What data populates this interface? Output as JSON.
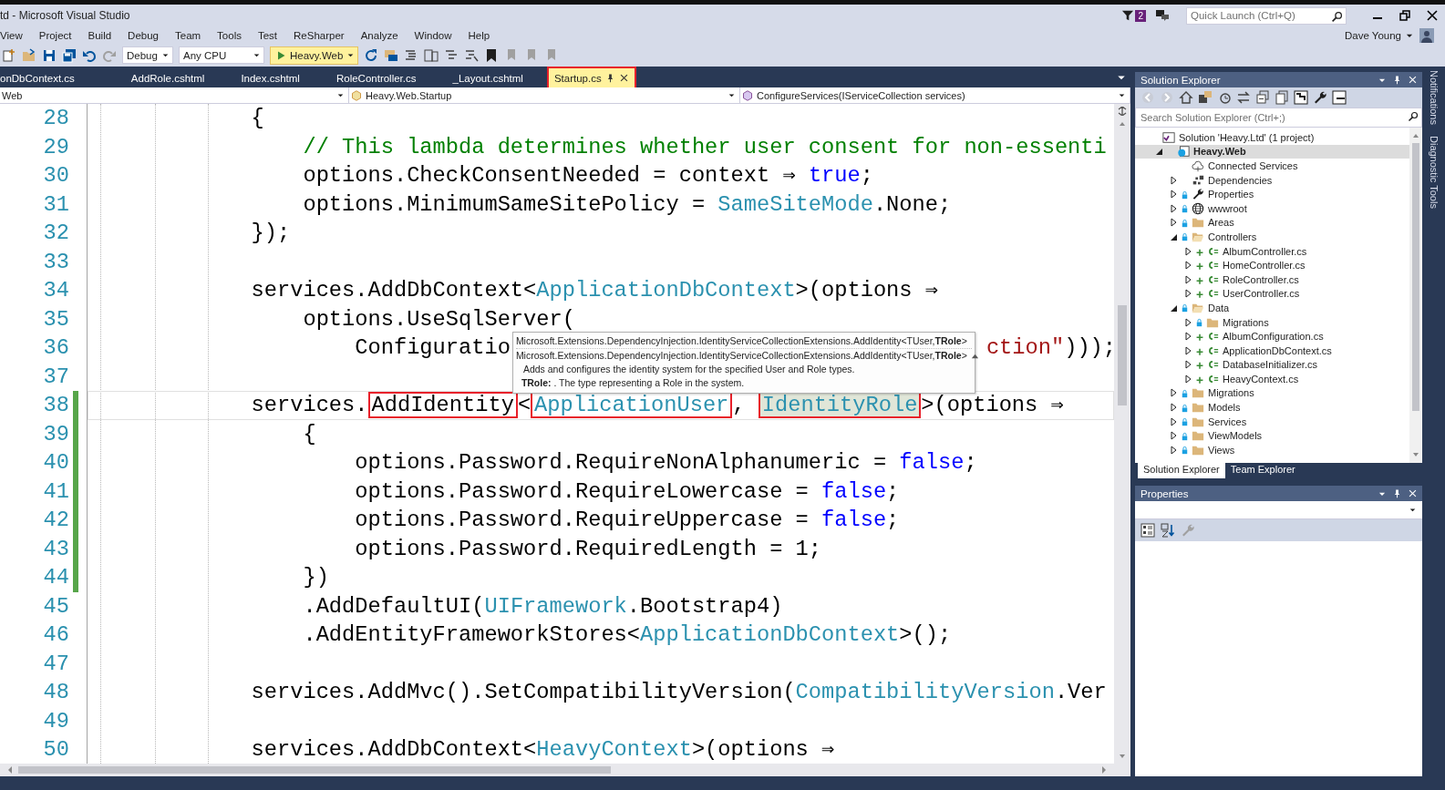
{
  "window": {
    "title": "td - Microsoft Visual Studio"
  },
  "notifications": {
    "count": "2"
  },
  "quick_launch": {
    "placeholder": "Quick Launch (Ctrl+Q)"
  },
  "menu": [
    "View",
    "Project",
    "Build",
    "Debug",
    "Team",
    "Tools",
    "Test",
    "ReSharper",
    "Analyze",
    "Window",
    "Help"
  ],
  "account": {
    "name": "Dave Young"
  },
  "toolbar": {
    "configuration": "Debug",
    "platform": "Any CPU",
    "start": "Heavy.Web"
  },
  "tabs": [
    {
      "label": "onDbContext.cs",
      "selected": false,
      "boxed": false
    },
    {
      "label": "AddRole.cshtml",
      "selected": false,
      "boxed": false
    },
    {
      "label": "Index.cshtml",
      "selected": false,
      "boxed": false
    },
    {
      "label": "RoleController.cs",
      "selected": false,
      "boxed": false
    },
    {
      "label": "_Layout.cshtml",
      "selected": false,
      "boxed": false
    },
    {
      "label": "Startup.cs",
      "selected": true,
      "boxed": true
    }
  ],
  "navigation": {
    "project": "Web",
    "type": "Heavy.Web.Startup",
    "member": "ConfigureServices(IServiceCollection services)"
  },
  "editor": {
    "lines": [
      {
        "n": "28",
        "changed": false,
        "current": false,
        "tokens": [
          {
            "t": "            {",
            "kind": "plain"
          }
        ]
      },
      {
        "n": "29",
        "changed": false,
        "current": false,
        "tokens": [
          {
            "t": "                // This lambda determines whether user consent for non-essenti",
            "kind": "comment"
          }
        ]
      },
      {
        "n": "30",
        "changed": false,
        "current": false,
        "tokens": [
          {
            "t": "                options.CheckConsentNeeded = context ⇒ ",
            "kind": "plain"
          },
          {
            "t": "true",
            "kind": "keyword"
          },
          {
            "t": ";",
            "kind": "plain"
          }
        ]
      },
      {
        "n": "31",
        "changed": false,
        "current": false,
        "tokens": [
          {
            "t": "                options.MinimumSameSitePolicy = ",
            "kind": "plain"
          },
          {
            "t": "SameSiteMode",
            "kind": "type"
          },
          {
            "t": ".None;",
            "kind": "plain"
          }
        ]
      },
      {
        "n": "32",
        "changed": false,
        "current": false,
        "tokens": [
          {
            "t": "            });",
            "kind": "plain"
          }
        ]
      },
      {
        "n": "33",
        "changed": false,
        "current": false
      },
      {
        "n": "34",
        "changed": false,
        "current": false,
        "tokens": [
          {
            "t": "            services.AddDbContext<",
            "kind": "plain"
          },
          {
            "t": "ApplicationDbContext",
            "kind": "type"
          },
          {
            "t": ">(options ⇒",
            "kind": "plain"
          }
        ]
      },
      {
        "n": "35",
        "changed": false,
        "current": false,
        "tokens": [
          {
            "t": "                options.UseSqlServer(",
            "kind": "plain"
          }
        ]
      },
      {
        "n": "36",
        "changed": false,
        "current": false,
        "tokens": [
          {
            "t": "                    Configuratio",
            "kind": "plain"
          },
          {
            "kind": "popup"
          },
          {
            "t": "ction\"",
            "kind": "string"
          },
          {
            "t": ")));",
            "kind": "plain"
          }
        ]
      },
      {
        "n": "37",
        "changed": false,
        "current": false
      },
      {
        "n": "38",
        "changed": true,
        "current": true,
        "tokens": [
          {
            "t": "            services.",
            "kind": "plain",
            "boxed": false,
            "highlighted": false
          },
          {
            "t": "AddIdentity",
            "kind": "plain",
            "boxed": true,
            "highlighted": false
          },
          {
            "t": "<",
            "kind": "plain",
            "boxed": false,
            "highlighted": false
          },
          {
            "t": "ApplicationUser",
            "kind": "type",
            "boxed": true,
            "highlighted": false
          },
          {
            "t": ", ",
            "kind": "plain",
            "boxed": false,
            "highlighted": false
          },
          {
            "t": "IdentityRole",
            "kind": "type",
            "boxed": true,
            "highlighted": true
          },
          {
            "t": ">(options ⇒",
            "kind": "plain",
            "boxed": false,
            "highlighted": false
          }
        ]
      },
      {
        "n": "39",
        "changed": true,
        "current": false,
        "tokens": [
          {
            "t": "                {",
            "kind": "plain"
          }
        ]
      },
      {
        "n": "40",
        "changed": true,
        "current": false,
        "tokens": [
          {
            "t": "                    options.Password.RequireNonAlphanumeric = ",
            "kind": "plain"
          },
          {
            "t": "false",
            "kind": "keyword"
          },
          {
            "t": ";",
            "kind": "plain"
          }
        ]
      },
      {
        "n": "41",
        "changed": true,
        "current": false,
        "tokens": [
          {
            "t": "                    options.Password.RequireLowercase = ",
            "kind": "plain"
          },
          {
            "t": "false",
            "kind": "keyword"
          },
          {
            "t": ";",
            "kind": "plain"
          }
        ]
      },
      {
        "n": "42",
        "changed": true,
        "current": false,
        "tokens": [
          {
            "t": "                    options.Password.RequireUppercase = ",
            "kind": "plain"
          },
          {
            "t": "false",
            "kind": "keyword"
          },
          {
            "t": ";",
            "kind": "plain"
          }
        ]
      },
      {
        "n": "43",
        "changed": true,
        "current": false,
        "tokens": [
          {
            "t": "                    options.Password.RequiredLength = 1;",
            "kind": "plain"
          }
        ]
      },
      {
        "n": "44",
        "changed": true,
        "current": false,
        "tokens": [
          {
            "t": "                })",
            "kind": "plain"
          }
        ]
      },
      {
        "n": "45",
        "changed": false,
        "current": false,
        "tokens": [
          {
            "t": "                .AddDefaultUI(",
            "kind": "plain"
          },
          {
            "t": "UIFramework",
            "kind": "type"
          },
          {
            "t": ".Bootstrap4)",
            "kind": "plain"
          }
        ]
      },
      {
        "n": "46",
        "changed": false,
        "current": false,
        "tokens": [
          {
            "t": "                .AddEntityFrameworkStores<",
            "kind": "plain"
          },
          {
            "t": "ApplicationDbContext",
            "kind": "type"
          },
          {
            "t": ">();",
            "kind": "plain"
          }
        ]
      },
      {
        "n": "47",
        "changed": false,
        "current": false
      },
      {
        "n": "48",
        "changed": false,
        "current": false,
        "tokens": [
          {
            "t": "            services.AddMvc().SetCompatibilityVersion(",
            "kind": "plain"
          },
          {
            "t": "CompatibilityVersion",
            "kind": "type"
          },
          {
            "t": ".Ver",
            "kind": "plain"
          }
        ]
      },
      {
        "n": "49",
        "changed": false,
        "current": false
      },
      {
        "n": "50",
        "changed": false,
        "current": false,
        "tokens": [
          {
            "t": "            services.AddDbContext<",
            "kind": "plain"
          },
          {
            "t": "HeavyContext",
            "kind": "type"
          },
          {
            "t": ">(options ⇒",
            "kind": "plain"
          }
        ]
      }
    ],
    "tooltip": {
      "signatures": [
        "Microsoft.Extensions.DependencyInjection.IdentityServiceCollectionExtensions.AddIdentity<TUser,**TRole**>",
        "Microsoft.Extensions.DependencyInjection.IdentityServiceCollectionExtensions.AddIdentity<TUser,**TRole**>"
      ],
      "description": "Adds and configures the identity system for the specified User and Role types.",
      "parameter": "**TRole:** . The type representing a Role in the system."
    }
  },
  "solution_explorer": {
    "title": "Solution Explorer",
    "search_placeholder": "Search Solution Explorer (Ctrl+;)",
    "tree": [
      {
        "label": "Solution 'Heavy.Ltd' (1 project)",
        "kind": "solution",
        "selected": false,
        "locked": false,
        "added": false,
        "children": [
          {
            "label": "Heavy.Web",
            "kind": "web-project",
            "selected": true,
            "expanded": true,
            "locked": false,
            "added": false,
            "children": [
              {
                "label": "Connected Services",
                "kind": "cloud",
                "selected": false,
                "locked": false,
                "added": false
              },
              {
                "label": "Dependencies",
                "kind": "dependencies",
                "selected": false,
                "expanded": false,
                "locked": false,
                "added": false
              },
              {
                "label": "Properties",
                "kind": "wrench",
                "selected": false,
                "expanded": false,
                "locked": true,
                "added": false
              },
              {
                "label": "wwwroot",
                "kind": "globe",
                "selected": false,
                "expanded": false,
                "locked": true,
                "added": false
              },
              {
                "label": "Areas",
                "kind": "folder",
                "selected": false,
                "expanded": false,
                "locked": true,
                "added": false
              },
              {
                "label": "Controllers",
                "kind": "folder",
                "selected": false,
                "expanded": true,
                "locked": true,
                "added": false,
                "children": [
                  {
                    "label": "AlbumController.cs",
                    "kind": "csharp",
                    "selected": false,
                    "expanded": false,
                    "locked": false,
                    "added": true
                  },
                  {
                    "label": "HomeController.cs",
                    "kind": "csharp",
                    "selected": false,
                    "expanded": false,
                    "locked": false,
                    "added": true
                  },
                  {
                    "label": "RoleController.cs",
                    "kind": "csharp",
                    "selected": false,
                    "expanded": false,
                    "locked": false,
                    "added": true
                  },
                  {
                    "label": "UserController.cs",
                    "kind": "csharp",
                    "selected": false,
                    "expanded": false,
                    "locked": false,
                    "added": true
                  }
                ]
              },
              {
                "label": "Data",
                "kind": "folder",
                "selected": false,
                "expanded": true,
                "locked": true,
                "added": false,
                "children": [
                  {
                    "label": "Migrations",
                    "kind": "folder",
                    "selected": false,
                    "expanded": false,
                    "locked": true,
                    "added": false
                  },
                  {
                    "label": "AlbumConfiguration.cs",
                    "kind": "csharp",
                    "selected": false,
                    "expanded": false,
                    "locked": false,
                    "added": true
                  },
                  {
                    "label": "ApplicationDbContext.cs",
                    "kind": "csharp",
                    "selected": false,
                    "expanded": false,
                    "locked": false,
                    "added": true
                  },
                  {
                    "label": "DatabaseInitializer.cs",
                    "kind": "csharp",
                    "selected": false,
                    "expanded": false,
                    "locked": false,
                    "added": true
                  },
                  {
                    "label": "HeavyContext.cs",
                    "kind": "csharp",
                    "selected": false,
                    "expanded": false,
                    "locked": false,
                    "added": true
                  }
                ]
              },
              {
                "label": "Migrations",
                "kind": "folder",
                "selected": false,
                "expanded": false,
                "locked": true,
                "added": false
              },
              {
                "label": "Models",
                "kind": "folder",
                "selected": false,
                "expanded": false,
                "locked": true,
                "added": false
              },
              {
                "label": "Services",
                "kind": "folder",
                "selected": false,
                "expanded": false,
                "locked": true,
                "added": false
              },
              {
                "label": "ViewModels",
                "kind": "folder",
                "selected": false,
                "expanded": false,
                "locked": true,
                "added": false
              },
              {
                "label": "Views",
                "kind": "folder",
                "selected": false,
                "expanded": false,
                "locked": true,
                "added": false
              }
            ]
          }
        ]
      }
    ],
    "tabs": [
      {
        "label": "Solution Explorer",
        "selected": true
      },
      {
        "label": "Team Explorer",
        "selected": false
      }
    ]
  },
  "properties": {
    "title": "Properties"
  },
  "side_tabs": [
    "Notifications",
    "Diagnostic Tools"
  ]
}
